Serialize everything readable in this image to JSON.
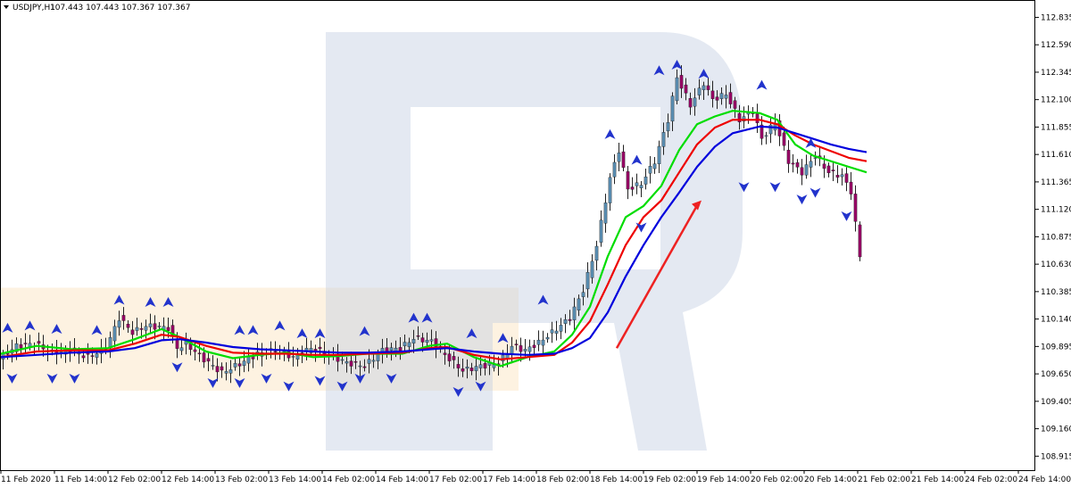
{
  "window": {
    "symbol": "USDJPY,H1",
    "quote": "107.443 107.443 107.367 107.367"
  },
  "chart_data": {
    "type": "line",
    "title": "USDJPY,H1",
    "ylim": [
      108.79,
      112.99
    ],
    "grid": false,
    "price_axis": {
      "ticks": [
        112.835,
        112.59,
        112.345,
        112.1,
        111.855,
        111.61,
        111.365,
        111.12,
        110.875,
        110.63,
        110.385,
        110.14,
        109.895,
        109.65,
        109.405,
        109.16,
        108.915
      ],
      "labels": [
        "112.835",
        "112.590",
        "112.345",
        "112.100",
        "111.855",
        "111.610",
        "111.365",
        "111.120",
        "110.875",
        "110.630",
        "110.385",
        "110.140",
        "109.895",
        "109.650",
        "109.405",
        "109.160",
        "108.915"
      ]
    },
    "time_axis": {
      "labels": [
        "11 Feb 2020",
        "11 Feb 14:00",
        "12 Feb 02:00",
        "12 Feb 14:00",
        "13 Feb 02:00",
        "13 Feb 14:00",
        "14 Feb 02:00",
        "14 Feb 14:00",
        "17 Feb 02:00",
        "17 Feb 14:00",
        "18 Feb 02:00",
        "18 Feb 14:00",
        "19 Feb 02:00",
        "19 Feb 14:00",
        "20 Feb 02:00",
        "20 Feb 14:00",
        "21 Feb 02:00",
        "21 Feb 14:00",
        "24 Feb 02:00",
        "24 Feb 14:00"
      ],
      "bars_per_label": 12
    },
    "range_zone": {
      "from_bar": 0,
      "to_bar": 116,
      "top": 110.42,
      "bottom": 109.5,
      "color": "#fdf0dc"
    },
    "series": [
      {
        "color": "#00dd00",
        "values": [
          [
            0,
            109.83
          ],
          [
            8,
            109.9
          ],
          [
            16,
            109.87
          ],
          [
            24,
            109.88
          ],
          [
            30,
            109.96
          ],
          [
            36,
            110.05
          ],
          [
            40,
            109.98
          ],
          [
            46,
            109.85
          ],
          [
            52,
            109.79
          ],
          [
            58,
            109.82
          ],
          [
            64,
            109.84
          ],
          [
            70,
            109.8
          ],
          [
            76,
            109.81
          ],
          [
            82,
            109.83
          ],
          [
            90,
            109.83
          ],
          [
            96,
            109.9
          ],
          [
            100,
            109.92
          ],
          [
            106,
            109.8
          ],
          [
            112,
            109.72
          ],
          [
            118,
            109.8
          ],
          [
            124,
            109.85
          ],
          [
            128,
            110.0
          ],
          [
            132,
            110.25
          ],
          [
            136,
            110.7
          ],
          [
            140,
            111.05
          ],
          [
            144,
            111.15
          ],
          [
            148,
            111.33
          ],
          [
            152,
            111.65
          ],
          [
            156,
            111.88
          ],
          [
            160,
            111.95
          ],
          [
            164,
            112.0
          ],
          [
            170,
            111.98
          ],
          [
            174,
            111.92
          ],
          [
            178,
            111.7
          ],
          [
            182,
            111.6
          ],
          [
            186,
            111.55
          ],
          [
            190,
            111.5
          ],
          [
            194,
            111.45
          ]
        ]
      },
      {
        "color": "#ee0000",
        "values": [
          [
            0,
            109.8
          ],
          [
            8,
            109.85
          ],
          [
            16,
            109.86
          ],
          [
            24,
            109.86
          ],
          [
            30,
            109.92
          ],
          [
            36,
            110.0
          ],
          [
            40,
            109.98
          ],
          [
            46,
            109.9
          ],
          [
            52,
            109.84
          ],
          [
            58,
            109.83
          ],
          [
            64,
            109.83
          ],
          [
            70,
            109.82
          ],
          [
            76,
            109.82
          ],
          [
            82,
            109.83
          ],
          [
            90,
            109.84
          ],
          [
            96,
            109.88
          ],
          [
            100,
            109.89
          ],
          [
            106,
            109.82
          ],
          [
            112,
            109.78
          ],
          [
            118,
            109.8
          ],
          [
            124,
            109.82
          ],
          [
            128,
            109.93
          ],
          [
            132,
            110.12
          ],
          [
            136,
            110.45
          ],
          [
            140,
            110.8
          ],
          [
            144,
            111.05
          ],
          [
            148,
            111.2
          ],
          [
            152,
            111.45
          ],
          [
            156,
            111.7
          ],
          [
            160,
            111.85
          ],
          [
            164,
            111.92
          ],
          [
            170,
            111.92
          ],
          [
            174,
            111.88
          ],
          [
            178,
            111.78
          ],
          [
            182,
            111.7
          ],
          [
            186,
            111.64
          ],
          [
            190,
            111.58
          ],
          [
            194,
            111.55
          ]
        ]
      },
      {
        "color": "#0000dd",
        "values": [
          [
            0,
            109.8
          ],
          [
            8,
            109.82
          ],
          [
            16,
            109.84
          ],
          [
            24,
            109.85
          ],
          [
            30,
            109.88
          ],
          [
            36,
            109.95
          ],
          [
            40,
            109.96
          ],
          [
            46,
            109.93
          ],
          [
            52,
            109.89
          ],
          [
            58,
            109.87
          ],
          [
            64,
            109.86
          ],
          [
            70,
            109.85
          ],
          [
            76,
            109.84
          ],
          [
            82,
            109.84
          ],
          [
            90,
            109.85
          ],
          [
            96,
            109.87
          ],
          [
            100,
            109.88
          ],
          [
            106,
            109.85
          ],
          [
            112,
            109.83
          ],
          [
            118,
            109.82
          ],
          [
            124,
            109.83
          ],
          [
            128,
            109.88
          ],
          [
            132,
            109.97
          ],
          [
            136,
            110.2
          ],
          [
            140,
            110.52
          ],
          [
            144,
            110.8
          ],
          [
            148,
            111.05
          ],
          [
            152,
            111.27
          ],
          [
            156,
            111.5
          ],
          [
            160,
            111.68
          ],
          [
            164,
            111.8
          ],
          [
            170,
            111.86
          ],
          [
            174,
            111.85
          ],
          [
            178,
            111.8
          ],
          [
            182,
            111.75
          ],
          [
            186,
            111.7
          ],
          [
            190,
            111.66
          ],
          [
            194,
            111.63
          ]
        ]
      }
    ],
    "price_path": [
      [
        0,
        109.78
      ],
      [
        4,
        109.9
      ],
      [
        8,
        109.92
      ],
      [
        12,
        109.84
      ],
      [
        16,
        109.86
      ],
      [
        20,
        109.8
      ],
      [
        24,
        109.88
      ],
      [
        27,
        110.15
      ],
      [
        30,
        110.02
      ],
      [
        33,
        110.08
      ],
      [
        38,
        110.06
      ],
      [
        40,
        109.88
      ],
      [
        42,
        109.92
      ],
      [
        46,
        109.78
      ],
      [
        50,
        109.66
      ],
      [
        54,
        109.74
      ],
      [
        58,
        109.83
      ],
      [
        62,
        109.86
      ],
      [
        66,
        109.8
      ],
      [
        70,
        109.88
      ],
      [
        74,
        109.82
      ],
      [
        78,
        109.75
      ],
      [
        82,
        109.72
      ],
      [
        86,
        109.86
      ],
      [
        90,
        109.88
      ],
      [
        93,
        109.97
      ],
      [
        97,
        109.94
      ],
      [
        100,
        109.82
      ],
      [
        104,
        109.68
      ],
      [
        108,
        109.72
      ],
      [
        112,
        109.74
      ],
      [
        115,
        109.9
      ],
      [
        118,
        109.86
      ],
      [
        121,
        109.93
      ],
      [
        124,
        110.02
      ],
      [
        128,
        110.15
      ],
      [
        131,
        110.4
      ],
      [
        134,
        110.8
      ],
      [
        137,
        111.4
      ],
      [
        139,
        111.65
      ],
      [
        141,
        111.3
      ],
      [
        144,
        111.35
      ],
      [
        147,
        111.55
      ],
      [
        150,
        111.92
      ],
      [
        152,
        112.3
      ],
      [
        155,
        112.05
      ],
      [
        158,
        112.25
      ],
      [
        160,
        112.1
      ],
      [
        163,
        112.15
      ],
      [
        166,
        111.92
      ],
      [
        169,
        112.0
      ],
      [
        171,
        111.75
      ],
      [
        174,
        111.9
      ],
      [
        177,
        111.55
      ],
      [
        180,
        111.45
      ],
      [
        183,
        111.6
      ],
      [
        186,
        111.45
      ],
      [
        189,
        111.42
      ],
      [
        191,
        111.28
      ],
      [
        193,
        110.7
      ]
    ],
    "fractals": [
      {
        "bar": 1,
        "up": true,
        "price": 110.05
      },
      {
        "bar": 6,
        "up": true,
        "price": 110.07
      },
      {
        "bar": 12,
        "up": true,
        "price": 110.04
      },
      {
        "bar": 21,
        "up": true,
        "price": 110.03
      },
      {
        "bar": 26,
        "up": true,
        "price": 110.3
      },
      {
        "bar": 33,
        "up": true,
        "price": 110.28
      },
      {
        "bar": 37,
        "up": true,
        "price": 110.28
      },
      {
        "bar": 53,
        "up": true,
        "price": 110.03
      },
      {
        "bar": 56,
        "up": true,
        "price": 110.03
      },
      {
        "bar": 62,
        "up": true,
        "price": 110.07
      },
      {
        "bar": 67,
        "up": true,
        "price": 110.0
      },
      {
        "bar": 71,
        "up": true,
        "price": 110.0
      },
      {
        "bar": 81,
        "up": true,
        "price": 110.02
      },
      {
        "bar": 92,
        "up": true,
        "price": 110.14
      },
      {
        "bar": 95,
        "up": true,
        "price": 110.14
      },
      {
        "bar": 105,
        "up": true,
        "price": 110.0
      },
      {
        "bar": 112,
        "up": true,
        "price": 109.96
      },
      {
        "bar": 121,
        "up": true,
        "price": 110.3
      },
      {
        "bar": 136,
        "up": true,
        "price": 111.78
      },
      {
        "bar": 142,
        "up": true,
        "price": 111.55
      },
      {
        "bar": 147,
        "up": true,
        "price": 112.35
      },
      {
        "bar": 151,
        "up": true,
        "price": 112.4
      },
      {
        "bar": 157,
        "up": true,
        "price": 112.32
      },
      {
        "bar": 170,
        "up": true,
        "price": 112.22
      },
      {
        "bar": 181,
        "up": true,
        "price": 111.7
      },
      {
        "bar": 2,
        "up": false,
        "price": 109.62
      },
      {
        "bar": 11,
        "up": false,
        "price": 109.62
      },
      {
        "bar": 16,
        "up": false,
        "price": 109.62
      },
      {
        "bar": 39,
        "up": false,
        "price": 109.72
      },
      {
        "bar": 47,
        "up": false,
        "price": 109.58
      },
      {
        "bar": 53,
        "up": false,
        "price": 109.58
      },
      {
        "bar": 59,
        "up": false,
        "price": 109.62
      },
      {
        "bar": 64,
        "up": false,
        "price": 109.55
      },
      {
        "bar": 71,
        "up": false,
        "price": 109.6
      },
      {
        "bar": 76,
        "up": false,
        "price": 109.55
      },
      {
        "bar": 80,
        "up": false,
        "price": 109.62
      },
      {
        "bar": 87,
        "up": false,
        "price": 109.62
      },
      {
        "bar": 102,
        "up": false,
        "price": 109.5
      },
      {
        "bar": 107,
        "up": false,
        "price": 109.55
      },
      {
        "bar": 143,
        "up": false,
        "price": 110.97
      },
      {
        "bar": 166,
        "up": false,
        "price": 111.33
      },
      {
        "bar": 173,
        "up": false,
        "price": 111.33
      },
      {
        "bar": 179,
        "up": false,
        "price": 111.22
      },
      {
        "bar": 182,
        "up": false,
        "price": 111.28
      },
      {
        "bar": 189,
        "up": false,
        "price": 111.07
      }
    ],
    "arrow": {
      "from": [
        138,
        109.88
      ],
      "to": [
        157,
        111.2
      ],
      "color": "#ee2222"
    },
    "colors": {
      "bull_candle": "#5b8fb4",
      "bear_candle": "#990066",
      "fractal": "#2233cc",
      "axis": "#000000",
      "watermark": "#c4cfe2"
    }
  }
}
